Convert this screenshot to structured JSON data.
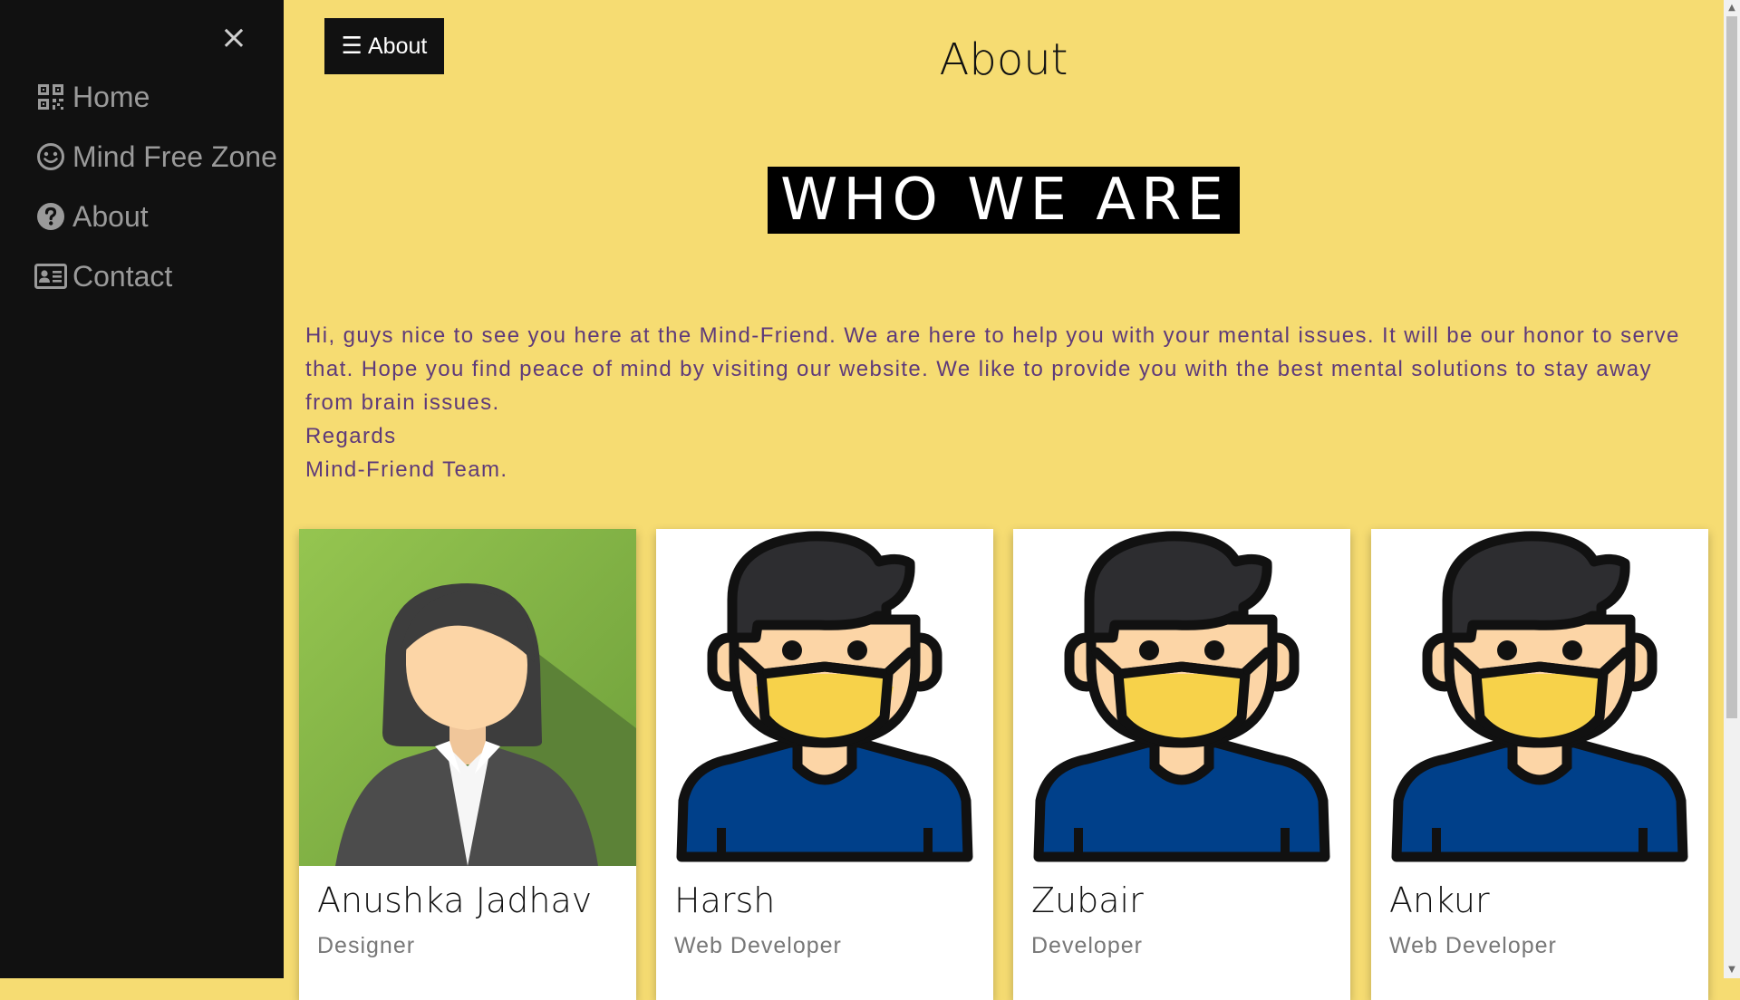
{
  "sidebar": {
    "close_label": "×",
    "items": [
      {
        "label": "Home",
        "icon": "qrcode-icon"
      },
      {
        "label": "Mind Free Zone",
        "icon": "smile-icon"
      },
      {
        "label": "About",
        "icon": "question-circle-icon"
      },
      {
        "label": "Contact",
        "icon": "address-card-icon"
      }
    ]
  },
  "header": {
    "menu_icon": "☰",
    "menu_label": "About",
    "title": "About"
  },
  "main": {
    "section_title": "WHO WE ARE",
    "intro_lines": [
      "Hi, guys nice to see you here at the Mind-Friend. We are here to help you with your mental issues. It will be our honor to serve that. Hope you find peace of mind by visiting our website. We like to provide you with the best mental solutions to stay away from brain issues.",
      "Regards",
      "Mind-Friend Team."
    ],
    "team": [
      {
        "name": "Anushka Jadhav",
        "role": "Designer",
        "avatar": "woman-avatar"
      },
      {
        "name": "Harsh",
        "role": "Web Developer",
        "avatar": "masked-man-avatar"
      },
      {
        "name": "Zubair",
        "role": "Developer",
        "avatar": "masked-man-avatar"
      },
      {
        "name": "Ankur",
        "role": "Web Developer",
        "avatar": "masked-man-avatar"
      }
    ]
  },
  "colors": {
    "background": "#f6dc72",
    "sidebar": "#111111",
    "intro_text": "#5e3a7a",
    "mask": "#f7d24a",
    "shirt": "#00408a"
  }
}
